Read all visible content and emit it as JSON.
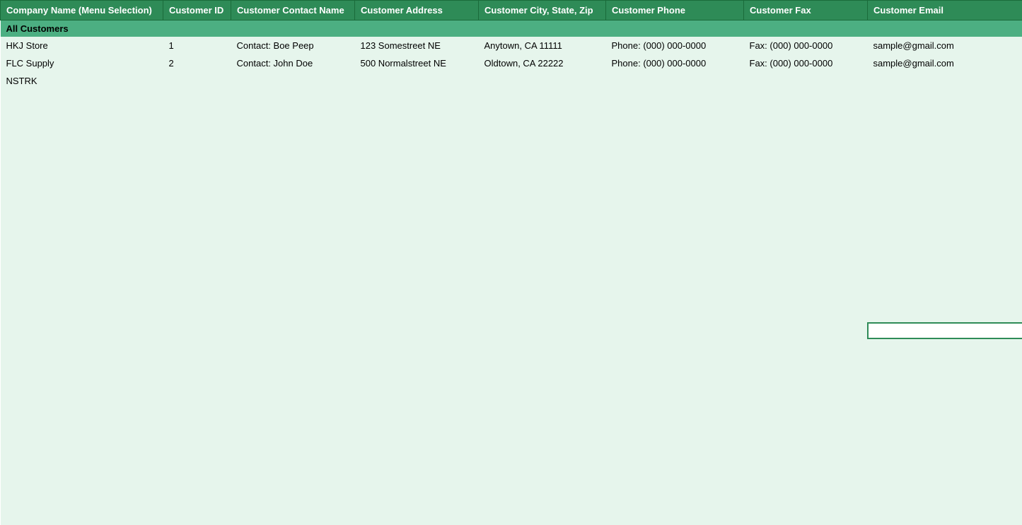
{
  "table": {
    "headers": [
      {
        "key": "company",
        "label": "Company Name (Menu Selection)"
      },
      {
        "key": "id",
        "label": "Customer ID"
      },
      {
        "key": "contact",
        "label": "Customer Contact Name"
      },
      {
        "key": "address",
        "label": "Customer Address"
      },
      {
        "key": "city",
        "label": "Customer City, State, Zip"
      },
      {
        "key": "phone",
        "label": "Customer Phone"
      },
      {
        "key": "fax",
        "label": "Customer Fax"
      },
      {
        "key": "email",
        "label": "Customer Email"
      }
    ],
    "group_label": "All Customers",
    "rows": [
      {
        "company": "HKJ Store",
        "id": "1",
        "contact": "Contact: Boe Peep",
        "address": "123 Somestreet NE",
        "city": "Anytown, CA 11111",
        "phone": "Phone: (000) 000-0000",
        "fax": "Fax: (000) 000-0000",
        "email": "sample@gmail.com"
      },
      {
        "company": "FLC Supply",
        "id": "2",
        "contact": "Contact: John Doe",
        "address": "500 Normalstreet NE",
        "city": "Oldtown, CA 22222",
        "phone": "Phone: (000) 000-0000",
        "fax": "Fax: (000) 000-0000",
        "email": "sample@gmail.com"
      },
      {
        "company": "NSTRK",
        "id": "",
        "contact": "",
        "address": "",
        "city": "",
        "phone": "",
        "fax": "",
        "email": ""
      }
    ],
    "empty_rows": 28
  }
}
